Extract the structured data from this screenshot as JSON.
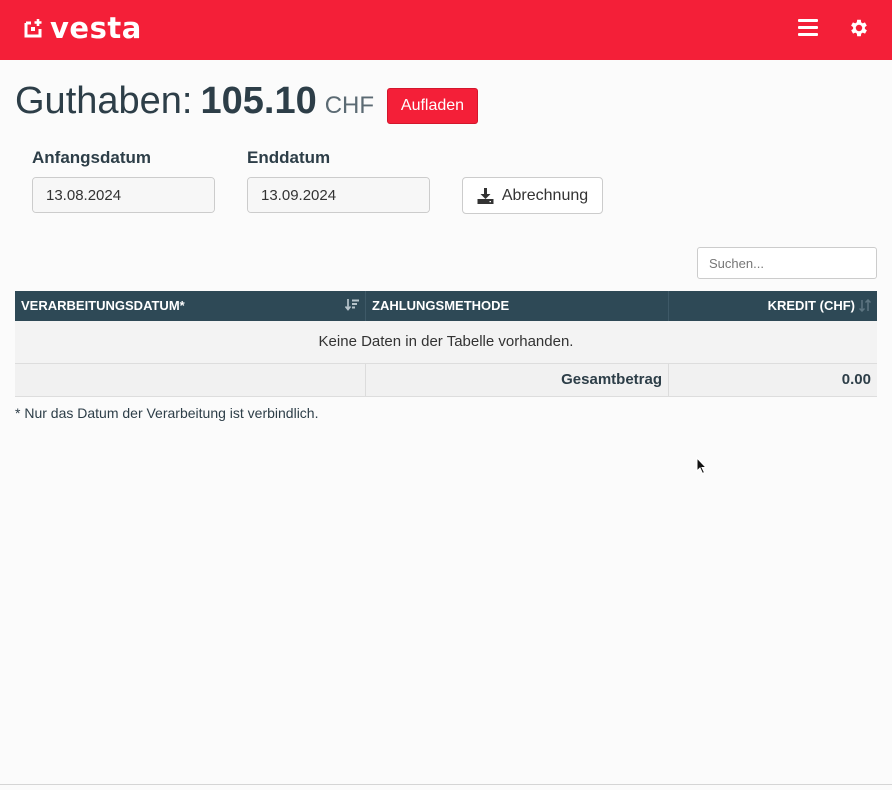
{
  "header": {
    "logo_text": "vesta",
    "brand_color": "#f41f38",
    "menu_icon": "hamburger-icon",
    "settings_icon": "gear-icon"
  },
  "balance": {
    "label": "Guthaben:",
    "amount": "105.10",
    "currency": "CHF",
    "topup_button": "Aufladen"
  },
  "filters": {
    "start_label": "Anfangsdatum",
    "start_value": "13.08.2024",
    "end_label": "Enddatum",
    "end_value": "13.09.2024",
    "export_button": "Abrechnung"
  },
  "search": {
    "placeholder": "Suchen..."
  },
  "table": {
    "columns": [
      "VERARBEITUNGSDATUM*",
      "ZAHLUNGSMETHODE",
      "KREDIT (CHF)"
    ],
    "empty_message": "Keine Daten in der Tabelle vorhanden.",
    "footer_label": "Gesamtbetrag",
    "footer_total": "0.00",
    "header_color": "#2e4956"
  },
  "note": "* Nur das Datum der Verarbeitung ist verbindlich."
}
